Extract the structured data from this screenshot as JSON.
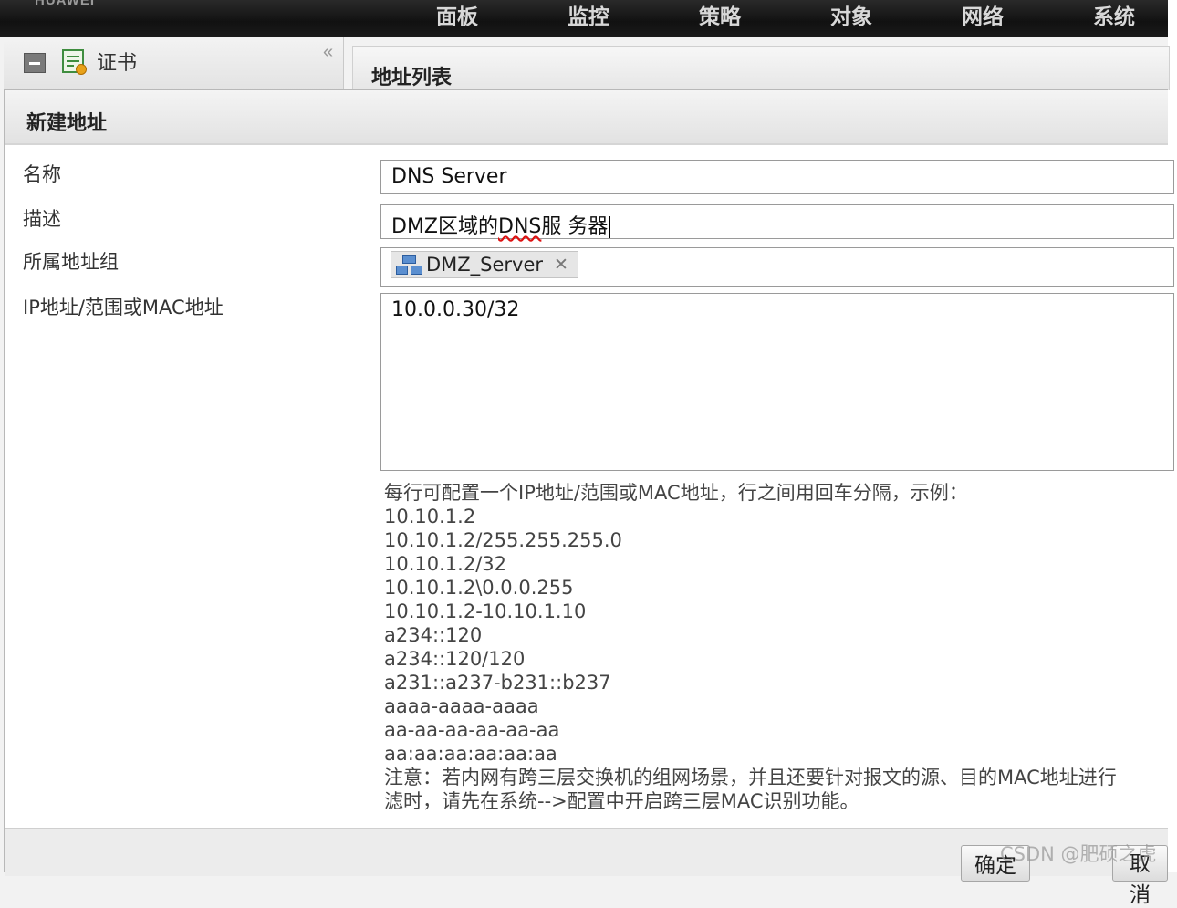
{
  "brand": "HUAWEI",
  "nav": [
    "面板",
    "监控",
    "策略",
    "对象",
    "网络",
    "系统"
  ],
  "left_panel": {
    "item_label": "证书"
  },
  "main": {
    "title": "地址列表"
  },
  "dialog": {
    "title": "新建地址",
    "labels": {
      "name": "名称",
      "description": "描述",
      "group": "所属地址组",
      "address": "IP地址/范围或MAC地址"
    },
    "values": {
      "name": "DNS Server",
      "description_pre": "DMZ区域的",
      "description_flag": "DNS",
      "description_post": "服 务器",
      "group_tag": "DMZ_Server",
      "address": "10.0.0.30/32"
    },
    "help": {
      "intro": "每行可配置一个IP地址/范围或MAC地址，行之间用回车分隔，示例：",
      "examples": [
        "10.10.1.2",
        "10.10.1.2/255.255.255.0",
        "10.10.1.2/32",
        "10.10.1.2\\0.0.0.255",
        "10.10.1.2-10.10.1.10",
        "a234::120",
        "a234::120/120",
        "a231::a237-b231::b237",
        "aaaa-aaaa-aaaa",
        "aa-aa-aa-aa-aa-aa",
        "aa:aa:aa:aa:aa:aa"
      ],
      "note_line1": "注意：若内网有跨三层交换机的组网场景，并且还要针对报文的源、目的MAC地址进行",
      "note_line2": "滤时，请先在系统-->配置中开启跨三层MAC识别功能。"
    },
    "buttons": {
      "ok": "确定",
      "cancel": "取消"
    }
  },
  "watermark": "CSDN @肥硕之虎"
}
